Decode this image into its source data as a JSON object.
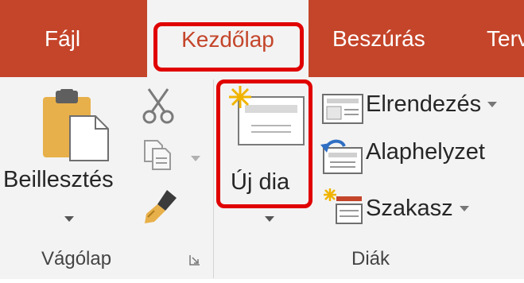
{
  "tabs": {
    "file": "Fájl",
    "home": "Kezdőlap",
    "insert": "Beszúrás",
    "design": "Terv"
  },
  "clipboard": {
    "paste_label": "Beillesztés",
    "group_label": "Vágólap",
    "icons": [
      "clipboard-icon",
      "scissors-icon",
      "copy-icon",
      "format-painter-icon",
      "dialog-launcher-icon"
    ]
  },
  "slides": {
    "new_slide_label": "Új dia",
    "layout_label": "Elrendezés",
    "reset_label": "Alaphelyzet",
    "section_label": "Szakasz",
    "group_label": "Diák",
    "icons": [
      "new-slide-icon",
      "layout-icon",
      "reset-icon",
      "section-icon"
    ]
  },
  "colors": {
    "tab_bar": "#c4452a",
    "ribbon_bg": "#f3f3f3",
    "highlight": "#e00000",
    "icon_gold": "#e8b04a"
  }
}
